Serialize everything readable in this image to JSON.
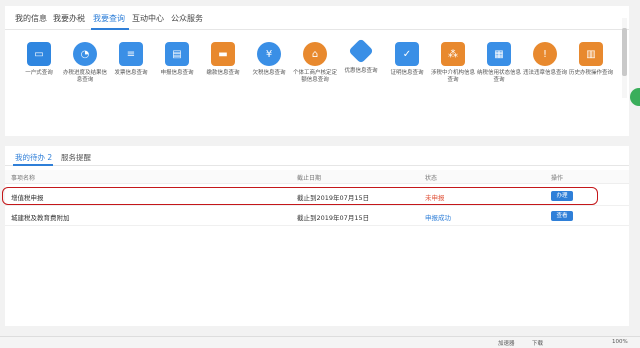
{
  "tabs": [
    "我的信息",
    "我要办税",
    "我要查询",
    "互动中心",
    "公众服务"
  ],
  "active_tab_index": 2,
  "services": [
    {
      "label": "一户式查询",
      "icon": "monitor-icon",
      "color": "#2f86e0"
    },
    {
      "label": "办税进度及结果信息查询",
      "icon": "pie-chart-icon",
      "color": "#3a8fe6"
    },
    {
      "label": "发票信息查询",
      "icon": "invoice-icon",
      "color": "#3a8fe6"
    },
    {
      "label": "申报信息查询",
      "icon": "declare-icon",
      "color": "#3a8fe6"
    },
    {
      "label": "缴款信息查询",
      "icon": "wallet-icon",
      "color": "#e8892e"
    },
    {
      "label": "欠税信息查询",
      "icon": "yen-icon",
      "color": "#3a8fe6"
    },
    {
      "label": "个体工商户核定定额信息查询",
      "icon": "shop-icon",
      "color": "#e8892e"
    },
    {
      "label": "优惠信息查询",
      "icon": "tag-icon",
      "color": "#3a8fe6"
    },
    {
      "label": "证明信息查询",
      "icon": "certificate-icon",
      "color": "#3a8fe6"
    },
    {
      "label": "涉税中介机构信息查询",
      "icon": "network-icon",
      "color": "#e8892e"
    },
    {
      "label": "纳税信用状态信息查询",
      "icon": "credit-icon",
      "color": "#3a8fe6"
    },
    {
      "label": "违法违章信息查询",
      "icon": "violation-icon",
      "color": "#e8892e"
    },
    {
      "label": "历史办税操作查询",
      "icon": "history-icon",
      "color": "#e8892e"
    }
  ],
  "lower_tabs": {
    "todo": "我的待办 2",
    "reminder": "服务提醒"
  },
  "table": {
    "headers": {
      "name": "事项名称",
      "deadline": "截止日期",
      "status": "状态",
      "action": "操作"
    },
    "rows": [
      {
        "name": "增值税申报",
        "deadline": "截止到2019年07月15日",
        "status": "未申报",
        "action": "办理"
      },
      {
        "name": "城建税及教育费附加",
        "deadline": "截止到2019年07月15日",
        "status": "申报成功",
        "action": "查看"
      }
    ]
  },
  "statusbar": {
    "accelerator": "加速器",
    "download": "下载",
    "zoom": "100%"
  }
}
